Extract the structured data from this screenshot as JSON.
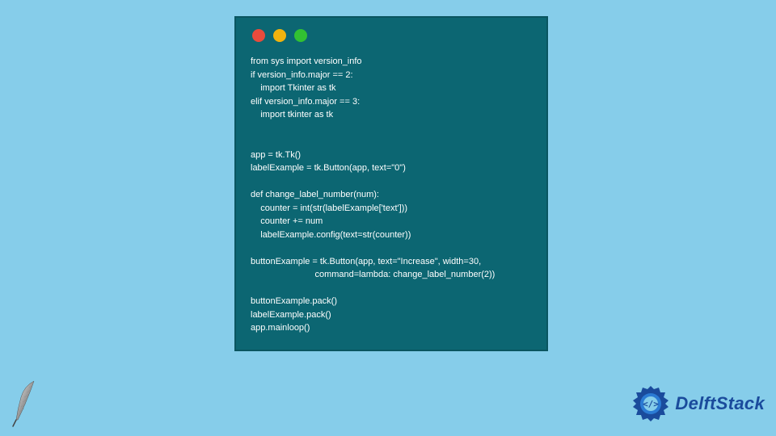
{
  "window": {
    "traffic_lights": [
      "red",
      "yellow",
      "green"
    ]
  },
  "code": {
    "text": "from sys import version_info\nif version_info.major == 2:\n    import Tkinter as tk\nelif version_info.major == 3:\n    import tkinter as tk\n\n\napp = tk.Tk()\nlabelExample = tk.Button(app, text=\"0\")\n\ndef change_label_number(num):\n    counter = int(str(labelExample['text']))\n    counter += num\n    labelExample.config(text=str(counter))\n\nbuttonExample = tk.Button(app, text=\"Increase\", width=30,\n                          command=lambda: change_label_number(2))\n\nbuttonExample.pack()\nlabelExample.pack()\napp.mainloop()"
  },
  "brand": {
    "name": "DelftStack"
  },
  "colors": {
    "background": "#86cdea",
    "code_bg": "#0c6672",
    "brand_blue": "#1a4b9c"
  }
}
